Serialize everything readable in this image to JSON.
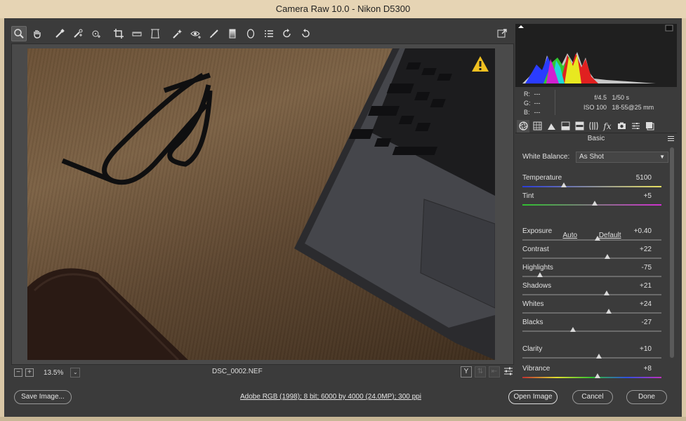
{
  "window": {
    "title": "Camera Raw 10.0  -  Nikon D5300"
  },
  "toolbar": {
    "tools": [
      {
        "name": "zoom-tool-icon"
      },
      {
        "name": "hand-tool-icon"
      },
      {
        "name": "white-balance-tool-icon"
      },
      {
        "name": "color-sampler-tool-icon"
      },
      {
        "name": "targeted-adjustment-tool-icon"
      },
      {
        "name": "crop-tool-icon"
      },
      {
        "name": "straighten-tool-icon"
      },
      {
        "name": "transform-tool-icon"
      },
      {
        "name": "spot-removal-tool-icon"
      },
      {
        "name": "red-eye-removal-icon"
      },
      {
        "name": "adjustment-brush-icon"
      },
      {
        "name": "graduated-filter-icon"
      },
      {
        "name": "radial-filter-icon"
      },
      {
        "name": "preferences-icon"
      },
      {
        "name": "rotate-ccw-icon"
      },
      {
        "name": "rotate-cw-icon"
      }
    ]
  },
  "status": {
    "zoom": "13.5%",
    "filename": "DSC_0002.NEF",
    "minus": "−",
    "plus": "+",
    "yview": "Y",
    "dropdown_arrow": "⌄"
  },
  "info": {
    "r_label": "R:",
    "r_val": "---",
    "g_label": "G:",
    "g_val": "---",
    "b_label": "B:",
    "b_val": "---",
    "aperture": "f/4.5",
    "shutter": "1/50 s",
    "iso": "ISO 100",
    "lens": "18-55@25 mm"
  },
  "panel": {
    "title": "Basic",
    "white_balance_label": "White Balance:",
    "white_balance_value": "As Shot",
    "auto": "Auto",
    "default": "Default",
    "sliders": [
      {
        "label": "Temperature",
        "value": "5100",
        "pos": 0.3
      },
      {
        "label": "Tint",
        "value": "+5",
        "pos": 0.52
      },
      {
        "label": "Exposure",
        "value": "+0.40",
        "pos": 0.54
      },
      {
        "label": "Contrast",
        "value": "+22",
        "pos": 0.61
      },
      {
        "label": "Highlights",
        "value": "-75",
        "pos": 0.125
      },
      {
        "label": "Shadows",
        "value": "+21",
        "pos": 0.605
      },
      {
        "label": "Whites",
        "value": "+24",
        "pos": 0.62
      },
      {
        "label": "Blacks",
        "value": "-27",
        "pos": 0.365
      },
      {
        "label": "Clarity",
        "value": "+10",
        "pos": 0.55
      },
      {
        "label": "Vibrance",
        "value": "+8",
        "pos": 0.54
      }
    ]
  },
  "bottom": {
    "save": "Save Image...",
    "workflow": "Adobe RGB (1998); 8 bit; 6000 by 4000 (24.0MP); 300 ppi",
    "open": "Open Image",
    "cancel": "Cancel",
    "done": "Done"
  },
  "colors": {
    "accent": "#f0c020",
    "panel_bg": "#3b3b3b"
  }
}
